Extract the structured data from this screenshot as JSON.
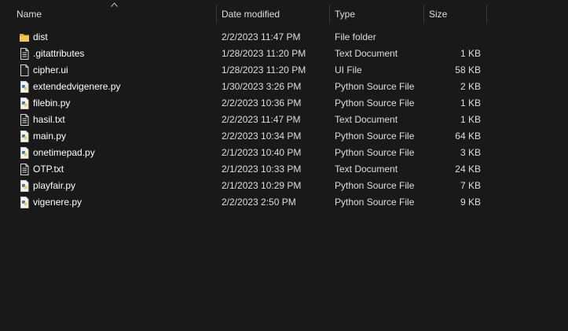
{
  "columns": {
    "name": "Name",
    "date": "Date modified",
    "type": "Type",
    "size": "Size"
  },
  "colors": {
    "background": "#191919",
    "text": "#dedede",
    "folder": "#f1c84b",
    "python_blue": "#3f78b5",
    "python_yellow": "#f3cd4a"
  },
  "files": [
    {
      "name": "dist",
      "date": "2/2/2023 11:47 PM",
      "type": "File folder",
      "size": "",
      "icon": "folder-icon"
    },
    {
      "name": ".gitattributes",
      "date": "1/28/2023 11:20 PM",
      "type": "Text Document",
      "size": "1 KB",
      "icon": "text-file-icon"
    },
    {
      "name": "cipher.ui",
      "date": "1/28/2023 11:20 PM",
      "type": "UI File",
      "size": "58 KB",
      "icon": "blank-file-icon"
    },
    {
      "name": "extendedvigenere.py",
      "date": "1/30/2023 3:26 PM",
      "type": "Python Source File",
      "size": "2 KB",
      "icon": "python-file-icon"
    },
    {
      "name": "filebin.py",
      "date": "2/2/2023 10:36 PM",
      "type": "Python Source File",
      "size": "1 KB",
      "icon": "python-file-icon"
    },
    {
      "name": "hasil.txt",
      "date": "2/2/2023 11:47 PM",
      "type": "Text Document",
      "size": "1 KB",
      "icon": "text-file-icon"
    },
    {
      "name": "main.py",
      "date": "2/2/2023 10:34 PM",
      "type": "Python Source File",
      "size": "64 KB",
      "icon": "python-file-icon"
    },
    {
      "name": "onetimepad.py",
      "date": "2/1/2023 10:40 PM",
      "type": "Python Source File",
      "size": "3 KB",
      "icon": "python-file-icon"
    },
    {
      "name": "OTP.txt",
      "date": "2/1/2023 10:33 PM",
      "type": "Text Document",
      "size": "24 KB",
      "icon": "text-file-icon"
    },
    {
      "name": "playfair.py",
      "date": "2/1/2023 10:29 PM",
      "type": "Python Source File",
      "size": "7 KB",
      "icon": "python-file-icon"
    },
    {
      "name": "vigenere.py",
      "date": "2/2/2023 2:50 PM",
      "type": "Python Source File",
      "size": "9 KB",
      "icon": "python-file-icon"
    }
  ]
}
